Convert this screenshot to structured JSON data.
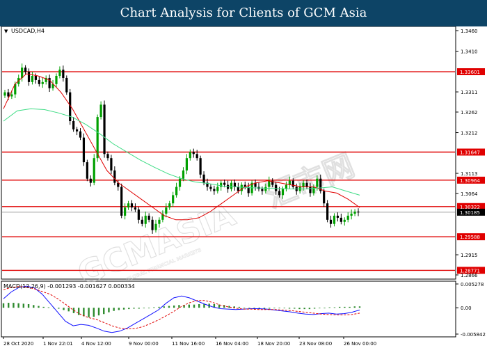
{
  "header": {
    "title": "Chart Analysis for Clients of GCM Asia"
  },
  "watermark": {
    "brand": "GCMASIA",
    "chinese": "汇市网",
    "tagline": "GLOBAL FINANCIAL MARKETS"
  },
  "colors": {
    "banner": "#0d4466",
    "level": "#e00000",
    "ema_fast": "#e00000",
    "ema_slow": "#3ddc84",
    "bull": "#00a000",
    "bear": "#000000",
    "macd_line": "#1010ff",
    "signal_line": "#e00000",
    "hist": "#2e8b2e"
  },
  "chart_data": [
    {
      "type": "candlestick",
      "title": "USDCAD,H4",
      "x_labels": [
        "28 Oct 2020",
        "1 Nov 22:01",
        "4 Nov 12:00",
        "9 Nov 00:00",
        "11 Nov 16:00",
        "16 Nov 04:00",
        "18 Nov 20:00",
        "23 Nov 08:00",
        "26 Nov 00:00"
      ],
      "y_ticks": [
        1.346,
        1.341,
        1.3311,
        1.3262,
        1.3212,
        1.3113,
        1.3064,
        1.2915,
        1.2866
      ],
      "ylim": [
        1.2866,
        1.346
      ],
      "levels": [
        1.33601,
        1.31647,
        1.30964,
        1.30322,
        1.29588,
        1.28771
      ],
      "current_price": 1.30185,
      "closes": [
        1.331,
        1.33,
        1.3305,
        1.333,
        1.3345,
        1.337,
        1.336,
        1.3335,
        1.335,
        1.334,
        1.333,
        1.3335,
        1.3345,
        1.332,
        1.333,
        1.335,
        1.3365,
        1.3345,
        1.331,
        1.324,
        1.322,
        1.3215,
        1.32,
        1.314,
        1.31,
        1.309,
        1.315,
        1.325,
        1.328,
        1.316,
        1.315,
        1.312,
        1.309,
        1.308,
        1.301,
        1.303,
        1.304,
        1.303,
        1.3025,
        1.3,
        1.299,
        1.301,
        1.3,
        1.2975,
        1.299,
        1.3,
        1.3015,
        1.303,
        1.304,
        1.306,
        1.308,
        1.31,
        1.312,
        1.315,
        1.3165,
        1.316,
        1.315,
        1.311,
        1.309,
        1.308,
        1.3075,
        1.307,
        1.308,
        1.309,
        1.3085,
        1.3075,
        1.309,
        1.308,
        1.307,
        1.3085,
        1.308,
        1.3065,
        1.309,
        1.308,
        1.3075,
        1.307,
        1.308,
        1.3095,
        1.3085,
        1.307,
        1.306,
        1.3075,
        1.3085,
        1.3095,
        1.308,
        1.307,
        1.308,
        1.309,
        1.308,
        1.3065,
        1.308,
        1.31,
        1.307,
        1.304,
        1.3,
        1.299,
        1.301,
        1.3005,
        1.2995,
        1.3,
        1.301,
        1.3015,
        1.302,
        1.3018
      ],
      "ema_fast": [
        1.327,
        1.333,
        1.3355,
        1.335,
        1.334,
        1.331,
        1.327,
        1.322,
        1.317,
        1.312,
        1.309,
        1.307,
        1.305,
        1.303,
        1.301,
        1.3,
        1.3,
        1.3005,
        1.302,
        1.304,
        1.306,
        1.308,
        1.309,
        1.3095,
        1.309,
        1.3085,
        1.308,
        1.308,
        1.307,
        1.3065,
        1.305,
        1.303
      ],
      "ema_slow": [
        1.324,
        1.3265,
        1.327,
        1.3268,
        1.326,
        1.325,
        1.3232,
        1.321,
        1.3185,
        1.3165,
        1.3145,
        1.3128,
        1.3112,
        1.31,
        1.3092,
        1.3088,
        1.3082,
        1.308,
        1.3078,
        1.3077,
        1.3076,
        1.3075,
        1.3075,
        1.3077,
        1.308,
        1.307,
        1.306
      ]
    },
    {
      "type": "macd",
      "title": "MACD(12,26,9) -0.001293 -0.001627 0.000334",
      "y_ticks": [
        0.005278,
        0.0,
        -0.005842
      ],
      "ylim": [
        -0.005842,
        0.005278
      ],
      "macd": [
        0.002,
        0.0035,
        0.0045,
        0.0048,
        0.0044,
        0.003,
        0.001,
        -0.001,
        -0.003,
        -0.004,
        -0.0037,
        -0.0039,
        -0.0045,
        -0.0052,
        -0.0055,
        -0.0052,
        -0.0045,
        -0.0035,
        -0.0025,
        -0.0015,
        -0.0005,
        0.001,
        0.0022,
        0.0026,
        0.0022,
        0.0015,
        0.0008,
        0.0002,
        -0.0002,
        -0.0003,
        -0.0004,
        -0.0003,
        -0.0002,
        -0.0002,
        -0.0003,
        -0.0005,
        -0.0007,
        -0.0009,
        -0.0012,
        -0.0014,
        -0.0015,
        -0.0013,
        -0.0012,
        -0.0014,
        -0.0013,
        -0.001,
        -0.0005
      ],
      "signal": [
        0.004,
        0.0045,
        0.0047,
        0.0046,
        0.0042,
        0.0036,
        0.003,
        0.002,
        0.0008,
        -0.0005,
        -0.0015,
        -0.0022,
        -0.0026,
        -0.0033,
        -0.004,
        -0.0045,
        -0.0047,
        -0.0046,
        -0.0042,
        -0.0035,
        -0.0027,
        -0.0018,
        -0.0008,
        0.0003,
        0.0011,
        0.0016,
        0.0016,
        0.0012,
        0.0006,
        0.0002,
        -0.0001,
        -0.0003,
        -0.0003,
        -0.0004,
        -0.0004,
        -0.0004,
        -0.0005,
        -0.0006,
        -0.0008,
        -0.001,
        -0.0012,
        -0.0014,
        -0.0015,
        -0.0016,
        -0.0016,
        -0.0015,
        -0.0012
      ],
      "histogram": [
        0.001,
        0.0011,
        0.0011,
        0.001,
        0.0009,
        0.0008,
        0.0006,
        0.0004,
        0.0002,
        0.0001,
        0.0,
        -0.0002,
        -0.0005,
        -0.0008,
        -0.0012,
        -0.0016,
        -0.0019,
        -0.0021,
        -0.002,
        -0.0017,
        -0.0014,
        -0.001,
        -0.0007,
        -0.0005,
        -0.0004,
        -0.0003,
        -0.0002,
        -0.0002,
        -0.0001,
        0.0,
        0.0001,
        0.0002,
        0.0003,
        0.0004,
        0.0005,
        0.0006,
        0.0006,
        0.0007,
        0.0007,
        0.0008,
        0.0008,
        0.0009,
        0.0008,
        0.0007,
        0.0006,
        0.0004,
        0.0003,
        0.0002,
        0.0,
        -0.0001,
        -0.0002,
        -0.0003,
        -0.0002,
        -0.0002,
        -0.0001,
        -0.0001,
        -0.0001,
        -0.0002,
        -0.0002,
        -0.0003,
        -0.0003,
        -0.0003,
        -0.0002,
        -0.0001,
        0.0,
        0.0001,
        0.0001,
        0.0002,
        0.0002,
        0.0002,
        0.0003,
        0.0003
      ]
    }
  ]
}
